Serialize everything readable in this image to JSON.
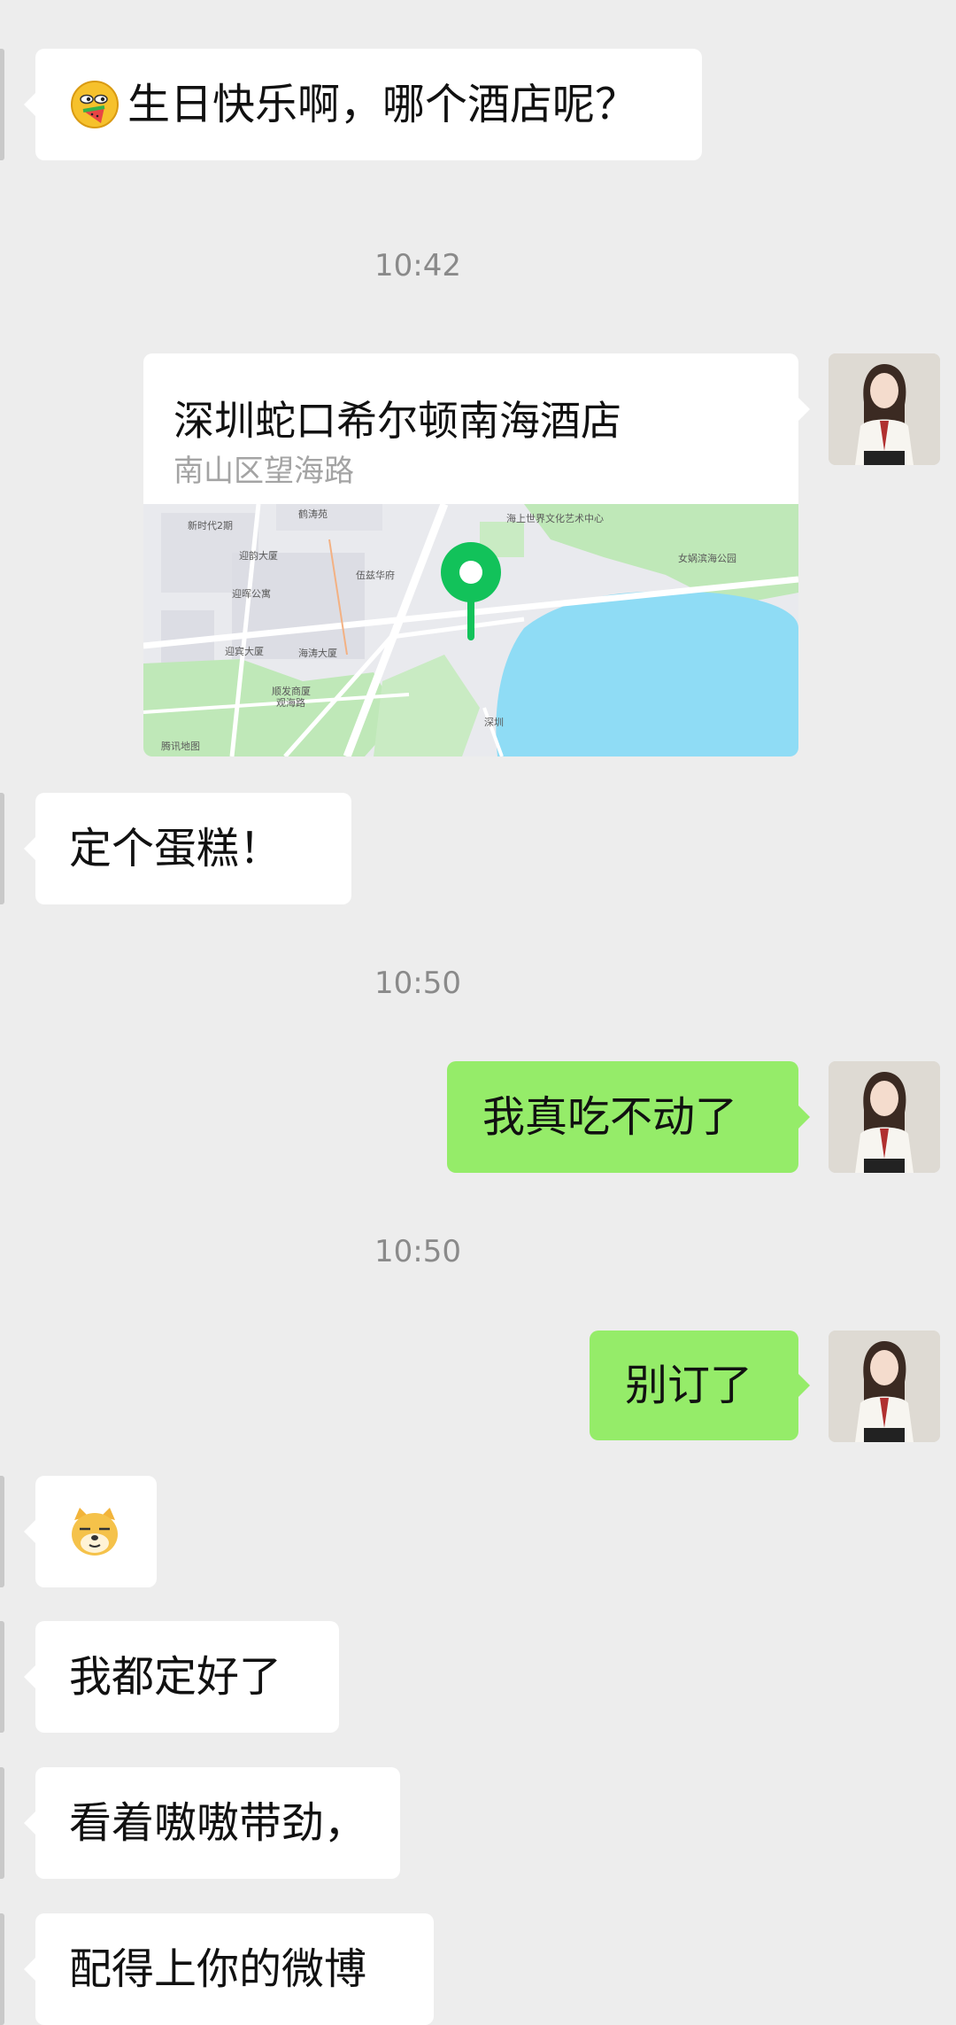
{
  "messages": {
    "m1": "生日快乐啊，哪个酒店呢？",
    "m2": "定个蛋糕！",
    "m3": "我真吃不动了",
    "m4": "别订了",
    "m5": "我都定好了",
    "m6": "看着嗷嗷带劲，",
    "m7": "配得上你的微博"
  },
  "timestamps": {
    "t1": "10:42",
    "t2": "10:50",
    "t3": "10:50"
  },
  "location": {
    "name": "深圳蛇口希尔顿南海酒店",
    "address": "南山区望海路",
    "map_labels": {
      "l1": "新时代2期",
      "l2": "迎韵大厦",
      "l3": "迎晖公寓",
      "l4": "迎宾大厦",
      "l5": "顺发商厦",
      "l6": "观海路",
      "l7": "伍兹华府",
      "l8": "海涛大厦",
      "l9": "海上世界文化艺术中心",
      "l10": "女娲滨海公园",
      "l11": "鹤涛苑",
      "l12": "深圳",
      "l13": "腾讯地图"
    }
  },
  "colors": {
    "background": "#ededed",
    "incoming_bubble": "#ffffff",
    "outgoing_bubble": "#95ec69",
    "map_pin": "#12c25a",
    "water": "#8fdcf5"
  },
  "icons": {
    "m1_emoji": "melon-eating-emoji",
    "doge_emoji": "doge-sticker-emoji",
    "map_pin": "location-pin-icon"
  }
}
